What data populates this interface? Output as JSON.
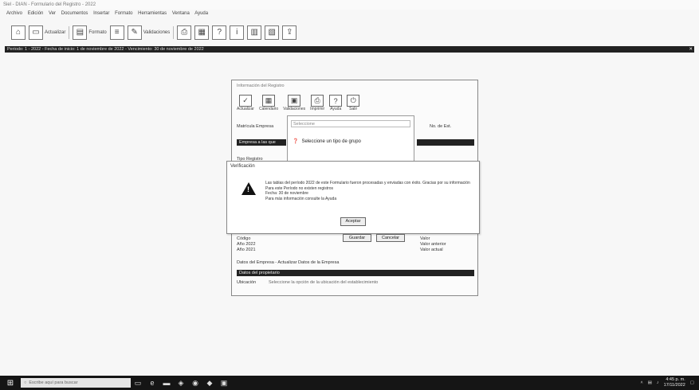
{
  "window": {
    "title": "Siel - DIAN - Formulario del Registro - 2022"
  },
  "menu": [
    "Archivo",
    "Edición",
    "Ver",
    "Documentos",
    "Insertar",
    "Formato",
    "Herramientas",
    "Ventana",
    "Ayuda"
  ],
  "toolbar": {
    "buttons": [
      {
        "icon": "home-icon",
        "label": ""
      },
      {
        "icon": "document-icon",
        "label": "Actualizar"
      },
      {
        "icon": "form-icon",
        "label": "Formato"
      },
      {
        "icon": "list-icon",
        "label": ""
      },
      {
        "icon": "edit-icon",
        "label": "Validaciones"
      },
      {
        "icon": "print-icon",
        "label": ""
      },
      {
        "icon": "grid-icon",
        "label": ""
      },
      {
        "icon": "help-icon",
        "label": ""
      },
      {
        "icon": "info-icon",
        "label": ""
      },
      {
        "icon": "chart-icon",
        "label": ""
      },
      {
        "icon": "table-icon",
        "label": ""
      },
      {
        "icon": "export-icon",
        "label": ""
      }
    ]
  },
  "status_bar": {
    "text": "Periodo: 1 - 2022 - Fecha de inicio: 1 de noviembre de 2022 - Vencimiento: 30 de noviembre de 2022"
  },
  "back_window": {
    "title": "Información del Registro",
    "ribbon": [
      "Actualizar",
      "Calendario",
      "Validaciones",
      "Imprimir",
      "Ayuda",
      "Salir"
    ],
    "label1": "Matrícula Empresa",
    "dark_row": "Empresa a las que",
    "right_label": "No. de Est.",
    "row_label2": "Tipo Registro",
    "footer_row": "Datos del Empresa - Actualizar Datos de la Empresa",
    "owner_bar": "Datos del propietario",
    "owner_label": "Ubicación",
    "owner_value": "Seleccione la opción de la ubicación del establecimiento",
    "grid_left": [
      "Código",
      "Año 2022",
      "Año 2021"
    ],
    "grid_right": [
      "Valor",
      "Valor anterior",
      "Valor actual"
    ]
  },
  "dropdown": {
    "placeholder": "Seleccione",
    "option": "Seleccione un tipo de grupo"
  },
  "modal": {
    "title": "Verificación",
    "message_lines": [
      "Las tablas del período 2022 de este Formulario fueron procesadas y enviadas con éxito. Gracias por su información",
      "Para este Período no existen registros",
      "Fecha: 30 de noviembre",
      "Para más información consulte la Ayuda"
    ],
    "ok_label": "Aceptar"
  },
  "under_buttons": {
    "save": "Guardar",
    "cancel": "Cancelar"
  },
  "taskbar": {
    "search_placeholder": "Escribe aquí para buscar",
    "time": "4:45 p. m.",
    "date": "17/11/2022"
  }
}
